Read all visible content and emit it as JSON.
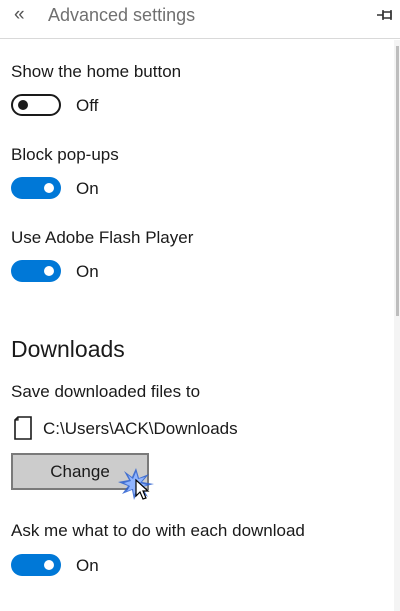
{
  "header": {
    "back_glyph": "«",
    "title": "Advanced settings",
    "pin_icon": "pin-icon"
  },
  "settings": {
    "home_button": {
      "label": "Show the home button",
      "state": "Off"
    },
    "block_popups": {
      "label": "Block pop-ups",
      "state": "On"
    },
    "flash": {
      "label": "Use Adobe Flash Player",
      "state": "On"
    }
  },
  "downloads": {
    "heading": "Downloads",
    "save_label": "Save downloaded files to",
    "path": "C:\\Users\\ACK\\Downloads",
    "change_label": "Change",
    "ask": {
      "label": "Ask me what to do with each download",
      "state": "On"
    }
  },
  "colors": {
    "accent": "#0078d7",
    "button_bg": "#cccccc"
  }
}
